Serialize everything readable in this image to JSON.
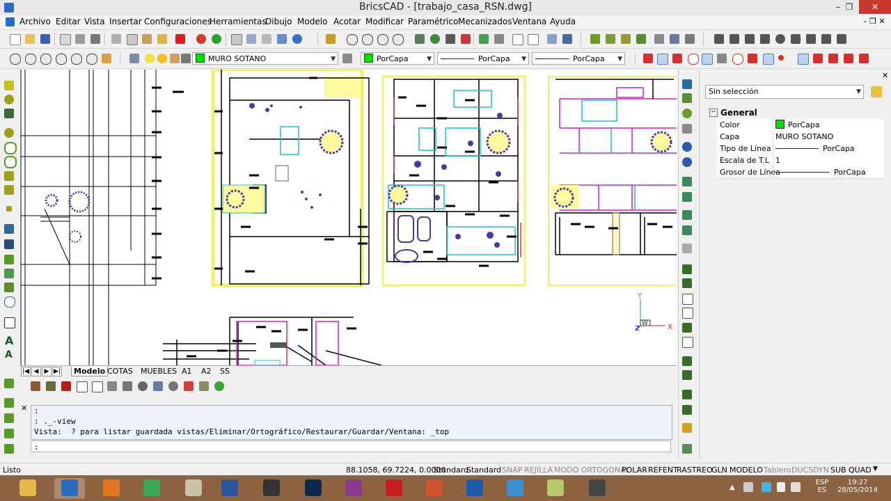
{
  "window": {
    "title": "BricsCAD - [trabajo_casa_RSN.dwg]",
    "controls": {
      "minimize": "–",
      "restore": "❐",
      "close": "✕"
    }
  },
  "menu": [
    "Archivo",
    "Editar",
    "Vista",
    "Insertar",
    "Configuraciones",
    "Herramientas",
    "Dibujo",
    "Modelo",
    "Acotar",
    "Modificar",
    "Paramétrico",
    "Mecanizados",
    "Ventana",
    "Ayuda"
  ],
  "layer_toolbar": {
    "layer_name": "MURO SOTANO",
    "color": "PorCapa",
    "linetype": "PorCapa",
    "lineweight": "PorCapa",
    "layer_color": "#00e000"
  },
  "tabs": [
    "Modelo",
    "COTAS",
    "MUEBLES",
    "A1",
    "A2",
    "SS"
  ],
  "active_tab": "Modelo",
  "command_line": {
    "history": [
      ":",
      ": ._-view",
      "Vista:  ? para listar guardada vistas/Eliminar/Ortográfico/Restaurar/Guardar/Ventana: _top"
    ],
    "prompt": ":"
  },
  "properties": {
    "selection": "Sin selección",
    "section": "General",
    "rows": [
      {
        "key": "Color",
        "value": "PorCapa"
      },
      {
        "key": "Capa",
        "value": "MURO SOTANO"
      },
      {
        "key": "Tipo de Línea",
        "value": "PorCapa"
      },
      {
        "key": "Escala de T.L",
        "value": "1"
      },
      {
        "key": "Grosor de Línea",
        "value": "PorCapa"
      }
    ]
  },
  "status": {
    "left": "Listo",
    "coords": "88.1058, 69.7224, 0.0000",
    "items": [
      {
        "label": "Standard",
        "on": true
      },
      {
        "label": "Standard",
        "on": true
      },
      {
        "label": "SNAP",
        "on": false
      },
      {
        "label": "REJILLA",
        "on": false
      },
      {
        "label": "MODO ORTOGONAL",
        "on": false
      },
      {
        "label": "POLAR",
        "on": true
      },
      {
        "label": "REFENT",
        "on": true
      },
      {
        "label": "RASTREO",
        "on": true
      },
      {
        "label": "GLN",
        "on": true
      },
      {
        "label": "MODELO",
        "on": true
      },
      {
        "label": "Tablero",
        "on": false
      },
      {
        "label": "DUCS",
        "on": false
      },
      {
        "label": "DYN",
        "on": false
      },
      {
        "label": "SUB",
        "on": true
      },
      {
        "label": "QUAD",
        "on": true
      }
    ]
  },
  "ucs": {
    "x": "X",
    "y": "Y",
    "z": "Z",
    "w": "W"
  },
  "taskbar": {
    "apps": [
      {
        "name": "file-explorer-icon",
        "color": "#e8b84a"
      },
      {
        "name": "bricscad-icon",
        "color": "#2a6cc0"
      },
      {
        "name": "firefox-icon",
        "color": "#e2761b"
      },
      {
        "name": "chrome-icon",
        "color": "#3aa757"
      },
      {
        "name": "paint-icon",
        "color": "#c9c2a8"
      },
      {
        "name": "word-icon",
        "color": "#2b579a"
      },
      {
        "name": "inkscape-icon",
        "color": "#333333"
      },
      {
        "name": "photoshop-icon",
        "color": "#0b2a4a"
      },
      {
        "name": "winrar-icon",
        "color": "#8a3b8f"
      },
      {
        "name": "acrobat-icon",
        "color": "#c6201e"
      },
      {
        "name": "powerpoint-icon",
        "color": "#d35230"
      },
      {
        "name": "google-earth-icon",
        "color": "#1f5aa8"
      },
      {
        "name": "globe-icon",
        "color": "#3b8fd0"
      },
      {
        "name": "notepad-icon",
        "color": "#b5c86a"
      },
      {
        "name": "media-icon",
        "color": "#444444"
      }
    ],
    "tray": {
      "lang_top": "ESP",
      "lang_bottom": "ES",
      "time": "19:27",
      "date": "28/05/2014"
    }
  }
}
